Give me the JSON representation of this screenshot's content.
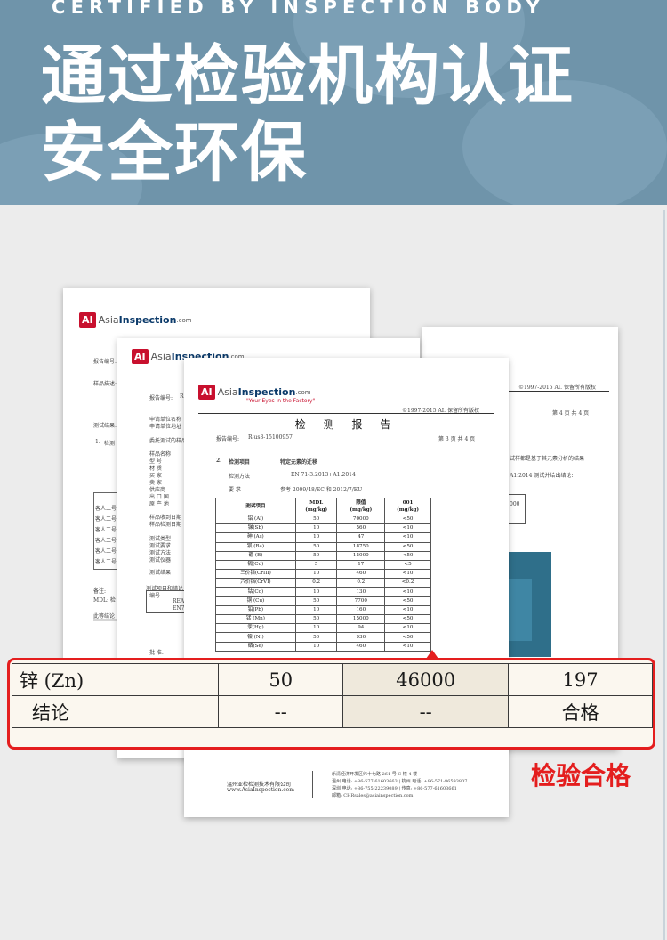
{
  "banner": {
    "subtitle": "CERTIFIED BY INSPECTION BODY",
    "line1": "通过检验机构认证",
    "line2": "安全环保"
  },
  "brand": {
    "badge": "AI",
    "asia": "Asia",
    "inspection": "Inspection",
    "com": ".com",
    "tagline": "\"Your Eyes in the Factory\""
  },
  "doc_back": {
    "report_no_label": "报告编号:",
    "sample_desc_label": "样品描述:",
    "test_result_label": "测试结果:",
    "section1": "1.",
    "section1_label": "检测",
    "row_prefix": "客人二号",
    "remark": "备注:",
    "mdl": "MDL: 检",
    "declaration": "此等结论",
    "bottom_label": "批"
  },
  "doc_mid": {
    "report_no_label": "报告编号:",
    "report_no": "R",
    "fields": [
      "申请单位名称",
      "申请单位地址",
      "委托测试的样品",
      "样品名称",
      "型    号",
      "材    质",
      "买    家",
      "卖    家",
      "供应商",
      "出 口 国",
      "原 产 地",
      "样品收到日期",
      "样品检测日期",
      "测试类型",
      "测试要求",
      "测试方法",
      "测试仪器",
      "测试结果"
    ],
    "project_label": "测试项目和结论",
    "no_label": "编号",
    "row1": "REA",
    "row2": "EN7",
    "sign": "批    准:"
  },
  "doc_right": {
    "copyright": "©1997-2015 AI. 保留所有版权",
    "page": "第 4 页 共 4 页",
    "note1": "试样都是基于其元素分析的结果",
    "note2": "A1:2014 测试并给出结论:",
    "note3": "000"
  },
  "doc_front": {
    "copyright": "©1997-2015 AI. 保留所有版权",
    "title": "检 测 报 告",
    "report_no_label": "报告编号:",
    "report_no": "R-us3-15100957",
    "page": "第 3 页 共 4 页",
    "section_no": "2.",
    "section_title": "检测项目",
    "section_value": "特定元素的迁移",
    "method_label": "检测方法",
    "method_value": "EN 71-3:2013+A1:2014",
    "req_label": "要    求",
    "req_value": "参考 2009/48/EC 和 2012/7/EU",
    "table_headers": [
      "测试项目",
      "MDL\n(mg/kg)",
      "限值\n(mg/kg)",
      "001\n(mg/kg)"
    ],
    "table_rows": [
      [
        "铝 (Al)",
        "50",
        "70000",
        "<50"
      ],
      [
        "锑(Sb)",
        "10",
        "560",
        "<10"
      ],
      [
        "砷 (As)",
        "10",
        "47",
        "<10"
      ],
      [
        "钡 (Ba)",
        "50",
        "18750",
        "<50"
      ],
      [
        "硼 (B)",
        "50",
        "15000",
        "<50"
      ],
      [
        "镉(Cd)",
        "5",
        "17",
        "<5"
      ],
      [
        "三价铬(CrIII)",
        "10",
        "460",
        "<10"
      ],
      [
        "六价铬(CrVI)",
        "0.2",
        "0.2",
        "<0.2"
      ],
      [
        "钴(Co)",
        "10",
        "130",
        "<10"
      ],
      [
        "铜 (Cu)",
        "50",
        "7700",
        "<50"
      ],
      [
        "铅(Pb)",
        "10",
        "160",
        "<10"
      ],
      [
        "锰 (Mn)",
        "50",
        "15000",
        "<50"
      ],
      [
        "汞(Hg)",
        "10",
        "94",
        "<10"
      ],
      [
        "镍 (Ni)",
        "50",
        "930",
        "<50"
      ],
      [
        "硒(Se)",
        "10",
        "460",
        "<10"
      ]
    ],
    "footer_company": "温州亚检检测技术有限公司",
    "footer_site": "www.AsiaInspection.com",
    "footer_addr": "乐清经济开发区纬十七路 261 号 C 幢 4 楼",
    "footer_contacts": [
      "温州  电话: +86-577-61603663  |  杭州  电话: +86-571-86593807",
      "深圳  电话: +86-755-22239089  |  传真: +86-577-61603661",
      "邮箱:   CHRsales@asiainspection.com"
    ]
  },
  "zoom_table": {
    "rows": [
      [
        "锌 (Zn)",
        "50",
        "46000",
        "197"
      ],
      [
        "结论",
        "--",
        "--",
        "合格"
      ]
    ]
  },
  "badge_pass": "检验合格",
  "colors": {
    "banner": "#6f94aa",
    "highlight": "#e41e1e",
    "brand_red": "#c8102e"
  }
}
